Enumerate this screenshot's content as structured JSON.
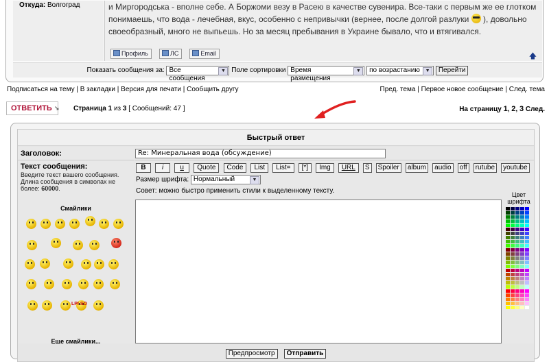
{
  "post": {
    "from_label": "Откуда:",
    "from_value": "Волгоград",
    "text_line1": "и Миргородська - вполне себе. А Боржоми везу в Расею в качестве сувенира. Все-таки с первым же ее глотком",
    "text_line2a": "понимаешь, что вода - лечебная, вкус, особенно с непривычки (вернее, после долгой разлуки",
    "text_line2b": "), довольно",
    "text_line3": "своеобразный, много не выпьешь. Но за месяц пребывания в Украине бывало, что и втягивался.",
    "buttons": [
      "Профиль",
      "ЛС",
      "Email"
    ]
  },
  "sort": {
    "show_label": "Показать сообщения за:",
    "show_value": "Все сообщения",
    "field_label": "Поле сортировки",
    "field_value": "Время размещения",
    "order_value": "по возрастанию",
    "go_button": "Перейти"
  },
  "links_left": [
    "Подписаться на тему",
    "В закладки",
    "Версия для печати",
    "Сообщить другу"
  ],
  "links_right": [
    "Пред. тема",
    "Первое новое сообщение",
    "След. тема"
  ],
  "reply_button": "ОТВЕТИТЬ",
  "page_info": {
    "page_label": "Страница",
    "page_current": "1",
    "of_label": "из",
    "page_total": "3",
    "posts_label": "[ Сообщений: 47 ]"
  },
  "pagination": {
    "label": "На страницу",
    "pages": [
      "1",
      "2",
      "3"
    ],
    "next": "След."
  },
  "quick_reply": {
    "header": "Быстрый ответ",
    "title_label": "Заголовок:",
    "title_value": "Re: Минеральная вода (обсуждение)",
    "message_label": "Текст сообщения:",
    "message_help_prefix": "Введите текст вашего сообщения. Длина сообщения в символах не более:",
    "message_help_max": "60000",
    "smilies_title": "Смайлики",
    "lpi_text": "LPI SO",
    "more_smilies": "Еще смайлики...",
    "bbcodes": [
      "B",
      "i",
      "u",
      "Quote",
      "Code",
      "List",
      "List=",
      "[*]",
      "Img",
      "URL",
      "S",
      "Spoiler",
      "album",
      "audio",
      "off",
      "rutube",
      "youtube"
    ],
    "font_size_label": "Размер шрифта:",
    "font_size_value": "Нормальный",
    "hint": "Совет: можно быстро применить стили к выделенному тексту.",
    "color_label": "Цвет шрифта",
    "preview_button": "Предпросмотр",
    "submit_button": "Отправить"
  },
  "colors": {
    "reply_red": "#b0163a",
    "annotation_arrow": "#e02020"
  }
}
